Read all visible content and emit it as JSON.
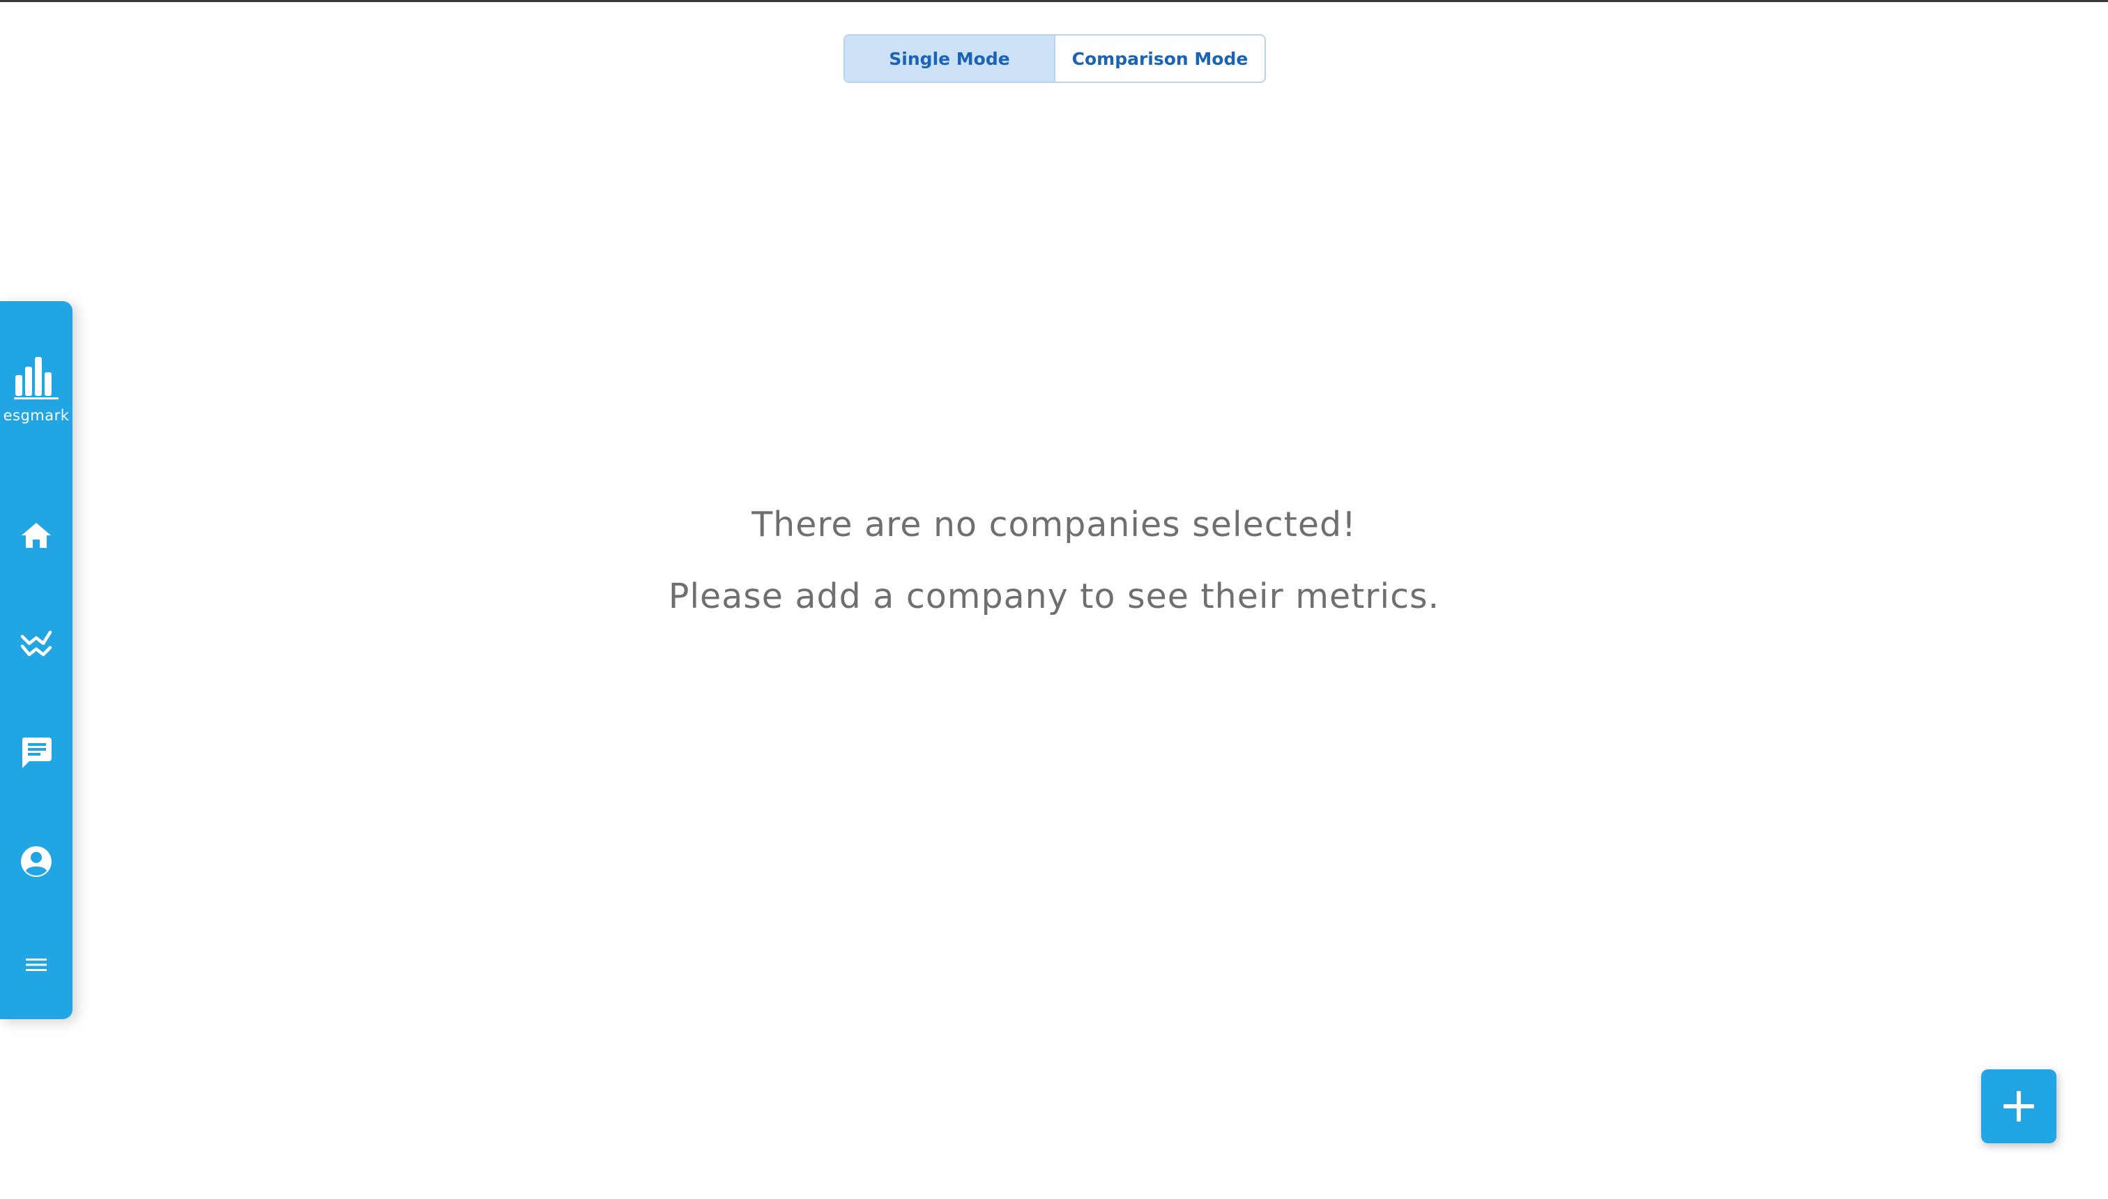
{
  "mode_toggle": {
    "single_label": "Single Mode",
    "comparison_label": "Comparison Mode",
    "selected": "Single Mode"
  },
  "sidebar": {
    "brand": "esgmark",
    "items": [
      {
        "icon": "home-icon"
      },
      {
        "icon": "trending-icon"
      },
      {
        "icon": "chat-icon"
      },
      {
        "icon": "account-icon"
      },
      {
        "icon": "menu-icon"
      }
    ]
  },
  "empty_state": {
    "line1": "There are no companies selected!",
    "line2": "Please add a company to see their metrics."
  },
  "fab": {
    "icon": "plus-icon"
  },
  "colors": {
    "accent": "#21a6e3",
    "toggle_active_bg": "#cde1f6",
    "toggle_text": "#1a63b5",
    "empty_text": "#6f6f6f"
  }
}
